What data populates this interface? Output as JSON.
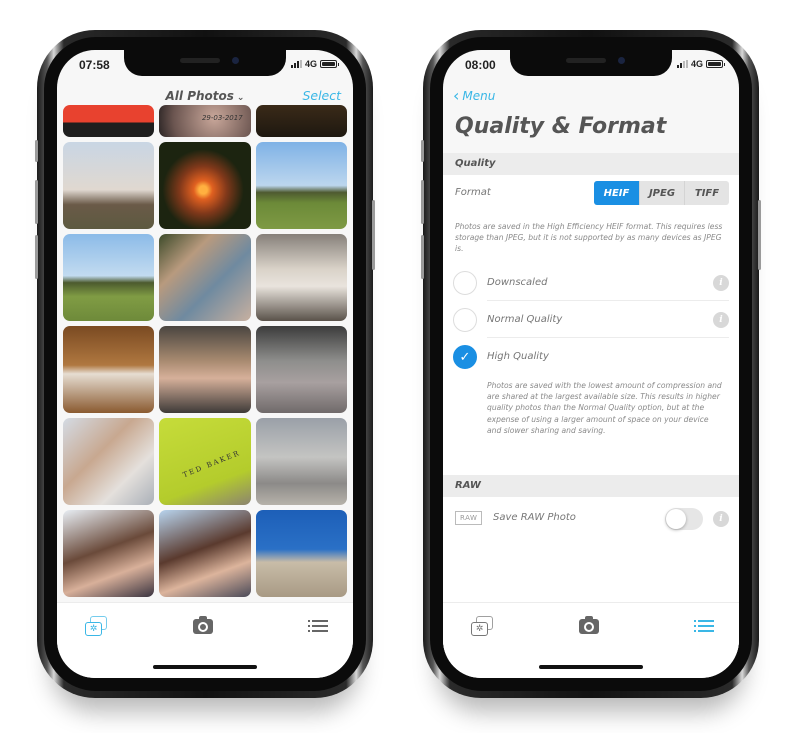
{
  "colors": {
    "accent": "#3ab7e6",
    "selected": "#1a8fe3",
    "text": "#555555",
    "muted": "#8a8a8a"
  },
  "phone1": {
    "status": {
      "time": "07:58",
      "network": "4G"
    },
    "nav": {
      "title": "All Photos",
      "title_icon": "chevron-down-icon",
      "select_label": "Select"
    },
    "photos": [
      {
        "subject": "red app screenshot"
      },
      {
        "subject": "tattoo",
        "caption": "29-03-2017"
      },
      {
        "subject": "dark evening scene"
      },
      {
        "subject": "dusk countryside"
      },
      {
        "subject": "tree at sunset"
      },
      {
        "subject": "green field"
      },
      {
        "subject": "field under blue sky"
      },
      {
        "subject": "couple selfie with sunglasses"
      },
      {
        "subject": "woman sitting outdoors"
      },
      {
        "subject": "waffles"
      },
      {
        "subject": "woman smiling in crowd"
      },
      {
        "subject": "stadium crowd"
      },
      {
        "subject": "couple selfie"
      },
      {
        "subject": "shopping bag",
        "caption": "TED BAKER"
      },
      {
        "subject": "marble arch"
      },
      {
        "subject": "woman selfie at fair"
      },
      {
        "subject": "woman selfie with sunglasses on head"
      },
      {
        "subject": "stone tower under blue sky"
      }
    ],
    "tabbar": [
      {
        "name": "gallery",
        "icon": "gallery-icon",
        "active": true
      },
      {
        "name": "camera",
        "icon": "camera-icon",
        "active": false
      },
      {
        "name": "settings",
        "icon": "list-icon",
        "active": false
      }
    ]
  },
  "phone2": {
    "status": {
      "time": "08:00",
      "network": "4G"
    },
    "nav": {
      "back_label": "Menu",
      "back_icon": "chevron-left-icon"
    },
    "title": "Quality & Format",
    "quality_section": {
      "header": "Quality",
      "format_label": "Format",
      "format_options": [
        "HEIF",
        "JPEG",
        "TIFF"
      ],
      "format_selected": "HEIF",
      "format_description": "Photos are saved in the High Efficiency HEIF format. This requires less storage than JPEG, but it is not supported by as many devices as JPEG is.",
      "options": [
        {
          "label": "Downscaled",
          "selected": false
        },
        {
          "label": "Normal Quality",
          "selected": false
        },
        {
          "label": "High Quality",
          "selected": true
        }
      ],
      "selected_description": "Photos are saved with the lowest amount of compression and are shared at the largest available size. This results in higher quality photos than the Normal Quality option, but at the expense of using a larger amount of space on your device and slower sharing and saving."
    },
    "raw_section": {
      "header": "RAW",
      "badge": "RAW",
      "label": "Save RAW Photo",
      "enabled": false
    },
    "info_glyph": "i",
    "check_glyph": "✓",
    "tabbar": [
      {
        "name": "gallery",
        "icon": "gallery-icon",
        "active": false
      },
      {
        "name": "camera",
        "icon": "camera-icon",
        "active": false
      },
      {
        "name": "settings",
        "icon": "list-icon",
        "active": true
      }
    ]
  }
}
